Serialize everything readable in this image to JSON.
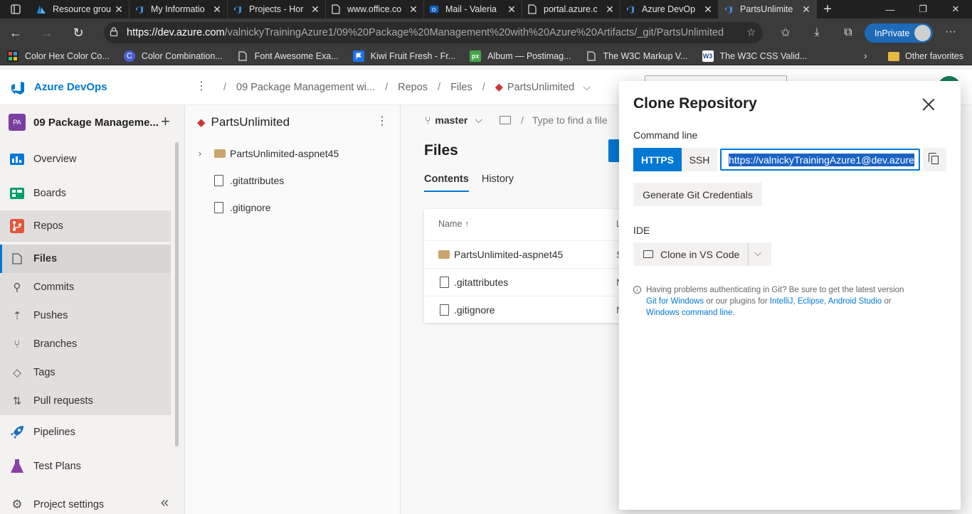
{
  "browser": {
    "tabs": [
      {
        "label": "Resource grou",
        "icon": "azure-icon"
      },
      {
        "label": "My Informatio",
        "icon": "devops-icon"
      },
      {
        "label": "Projects - Hor",
        "icon": "devops-icon"
      },
      {
        "label": "www.office.co",
        "icon": "page-icon"
      },
      {
        "label": "Mail - Valeria",
        "icon": "outlook-icon"
      },
      {
        "label": "portal.azure.c",
        "icon": "page-icon"
      },
      {
        "label": "Azure DevOp",
        "icon": "devops-icon"
      },
      {
        "label": "PartsUnlimite",
        "icon": "devops-icon"
      }
    ],
    "url_host": "https://dev.azure.com",
    "url_path": "/valnickyTrainingAzure1/09%20Package%20Management%20with%20Azure%20Artifacts/_git/PartsUnlimited",
    "inprivate_label": "InPrivate",
    "favorites": [
      {
        "label": "Color Hex Color Co...",
        "icon": "colorhex-icon",
        "color": "#222222"
      },
      {
        "label": "Color Combination...",
        "icon": "c-icon",
        "color": "#4a5fd6"
      },
      {
        "label": "Font Awesome Exa...",
        "icon": "page-icon",
        "color": "#3b3b3b"
      },
      {
        "label": "Kiwi Fruit Fresh - Fr...",
        "icon": "flag-icon",
        "color": "#1a73e8"
      },
      {
        "label": "Album — Postimag...",
        "icon": "px-icon",
        "color": "#3fa845"
      },
      {
        "label": "The W3C Markup V...",
        "icon": "page-icon",
        "color": "#3b3b3b"
      },
      {
        "label": "The W3C CSS Valid...",
        "icon": "w3-icon",
        "color": "#ffffff"
      }
    ],
    "other_favorites": "Other favorites"
  },
  "devops": {
    "app_name": "Azure DevOps",
    "breadcrumb": [
      "09 Package Management wi...",
      "Repos",
      "Files",
      "PartsUnlimited"
    ],
    "project_badge": "PA",
    "project_name": "09 Package Manageme...",
    "nav": [
      {
        "label": "Overview",
        "icon": "overview-icon"
      },
      {
        "label": "Boards",
        "icon": "boards-icon"
      },
      {
        "label": "Repos",
        "icon": "repos-icon"
      },
      {
        "label": "Files",
        "icon": "files-icon"
      },
      {
        "label": "Commits",
        "icon": "commits-icon"
      },
      {
        "label": "Pushes",
        "icon": "pushes-icon"
      },
      {
        "label": "Branches",
        "icon": "branches-icon"
      },
      {
        "label": "Tags",
        "icon": "tags-icon"
      },
      {
        "label": "Pull requests",
        "icon": "pull-requests-icon"
      },
      {
        "label": "Pipelines",
        "icon": "pipelines-icon"
      },
      {
        "label": "Test Plans",
        "icon": "test-plans-icon"
      },
      {
        "label": "Project settings",
        "icon": "settings-icon"
      }
    ],
    "tree": {
      "repo_name": "PartsUnlimited",
      "items": [
        {
          "label": "PartsUnlimited-aspnet45",
          "type": "folder"
        },
        {
          "label": ".gitattributes",
          "type": "file"
        },
        {
          "label": ".gitignore",
          "type": "file"
        }
      ]
    },
    "content": {
      "branch": "master",
      "find_placeholder": "Type to find a file",
      "heading": "Files",
      "tabs": [
        "Contents",
        "History"
      ],
      "name_header": "Name ↑",
      "second_header": "L",
      "rows": [
        {
          "name": "PartsUnlimited-aspnet45",
          "type": "folder",
          "trunc": "S"
        },
        {
          "name": ".gitattributes",
          "type": "file",
          "trunc": "N"
        },
        {
          "name": ".gitignore",
          "type": "file",
          "trunc": "N"
        }
      ]
    }
  },
  "dialog": {
    "title": "Clone Repository",
    "command_line_label": "Command line",
    "https_label": "HTTPS",
    "ssh_label": "SSH",
    "clone_url": "https://valnickyTrainingAzure1@dev.azure",
    "generate_label": "Generate Git Credentials",
    "ide_label": "IDE",
    "vscode_label": "Clone in VS Code",
    "help_text_1": "Having problems authenticating in Git? Be sure to get the latest version",
    "link_git_windows": "Git for Windows",
    "help_text_2": " or our plugins for ",
    "link_intellij": "IntelliJ",
    "link_eclipse": "Eclipse",
    "link_android": "Android Studio",
    "help_text_3": " or",
    "link_cmdline": "Windows command line",
    "help_text_4": "."
  }
}
